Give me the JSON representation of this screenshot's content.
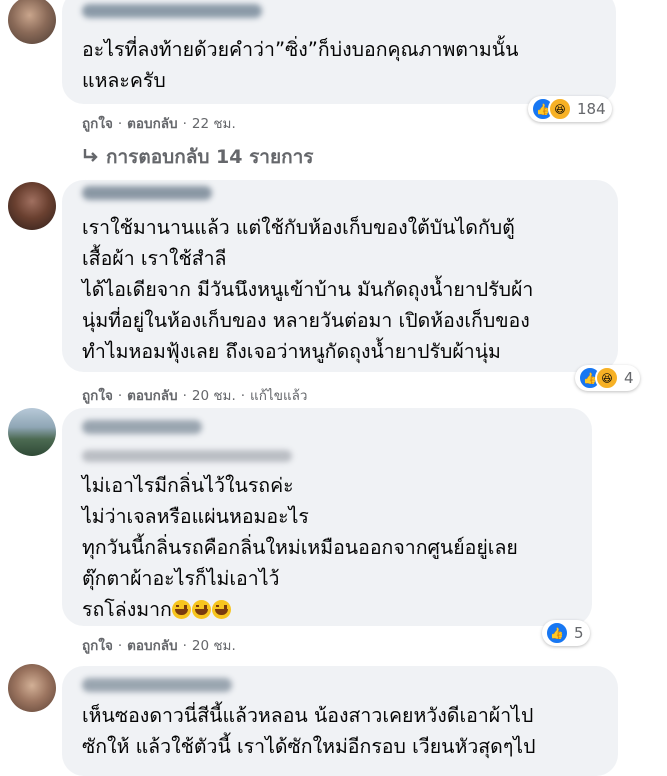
{
  "comments": [
    {
      "lines": [
        "อะไรที่ลงท้ายด้วยคำว่า”ซิ่ง”ก็บ่งบอกคุณภาพตามนั้น",
        "แหละครับ"
      ],
      "like_label": "ถูกใจ",
      "reply_label": "ตอบกลับ",
      "time": "22 ชม.",
      "reactions": [
        "like",
        "haha"
      ],
      "reaction_count": "184"
    },
    {
      "lines": [
        "เราใช้มานานแล้ว แต่ใช้กับห้องเก็บของใต้บันไดกับตู้",
        "เสื้อผ้า เราใช้สำลี",
        "ได้ไอเดียจาก มีวันนึงหนูเข้าบ้าน มันกัดถุงน้ำยาปรับผ้า",
        "นุ่มที่อยู่ในห้องเก็บของ หลายวันต่อมา เปิดห้องเก็บของ",
        "ทำไมหอมฟุ้งเลย ถึงเจอว่าหนูกัดถุงน้ำยาปรับผ้านุ่ม"
      ],
      "like_label": "ถูกใจ",
      "reply_label": "ตอบกลับ",
      "time": "20 ชม.",
      "edited": "แก้ไขแล้ว",
      "reactions": [
        "like",
        "haha"
      ],
      "reaction_count": "4"
    },
    {
      "lines": [
        "ไม่เอาไรมีกลิ่นไว้ในรถค่ะ",
        "ไม่ว่าเจลหรือแผ่นหอมอะไร",
        "ทุกวันนี้กลิ่นรถคือกลิ่นใหม่เหมือนออกจากศูนย์อยู่เลย",
        "ตุ๊กตาผ้าอะไรก็ไม่เอาไว้",
        "รถโล่งมาก"
      ],
      "emoji_trail": "grinning-sweat-face x3",
      "like_label": "ถูกใจ",
      "reply_label": "ตอบกลับ",
      "time": "20 ชม.",
      "reactions": [
        "like"
      ],
      "reaction_count": "5"
    },
    {
      "lines": [
        "เห็นซองดาวนี่สีนี้แล้วหลอน น้องสาวเคยหวังดีเอาผ้าไป",
        "ซักให้ แล้วใช้ตัวนี้ เราได้ซักใหม่อีกรอบ เวียนหัวสุดๆไป"
      ]
    }
  ],
  "replies_link": "การตอบกลับ 14 รายการ",
  "icons": {
    "reply_arrow": "reply-arrow-icon",
    "like": "like-thumb-icon",
    "haha": "haha-laugh-icon"
  },
  "colors": {
    "bubble": "#f0f2f5",
    "meta_text": "#65676b",
    "like_blue": "#1877f2",
    "haha_yellow": "#f7b125"
  }
}
